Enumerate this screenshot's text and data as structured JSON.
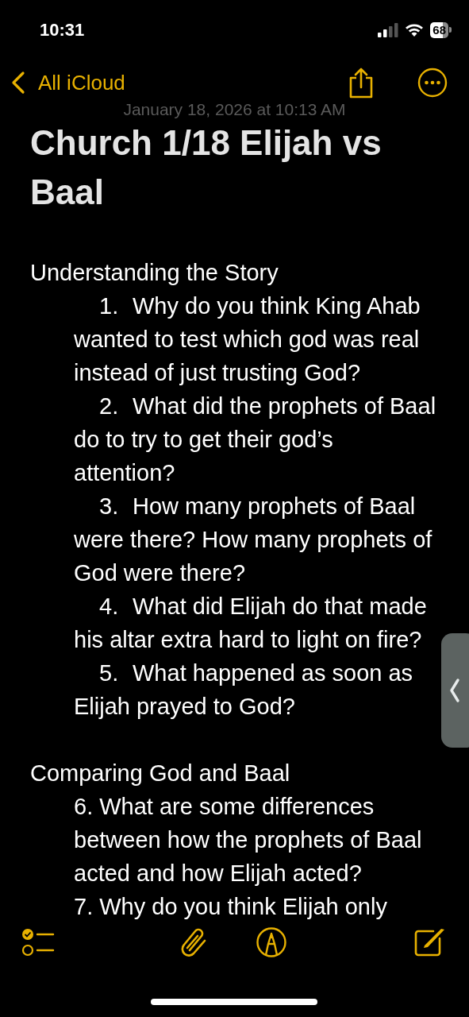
{
  "status_bar": {
    "time": "10:31",
    "battery": "68"
  },
  "nav": {
    "back_label": "All iCloud"
  },
  "note": {
    "date": "January 18, 2026 at 10:13 AM",
    "title": "Church 1/18 Elijah vs Baal",
    "sections": [
      {
        "heading": "Understanding the Story",
        "items": [
          {
            "kind": "numbered",
            "number": "1.",
            "text": "Why do you think King Ahab wanted to test which god was real instead of just trusting God?"
          },
          {
            "kind": "numbered",
            "number": "2.",
            "text": "What did the prophets of Baal do to try to get their god’s attention?"
          },
          {
            "kind": "numbered",
            "number": "3.",
            "text": "How many prophets of Baal were there? How many prophets of God were there?"
          },
          {
            "kind": "numbered",
            "number": "4.",
            "text": "What did Elijah do that made his altar extra hard to light on fire?"
          },
          {
            "kind": "numbered",
            "number": "5.",
            "text": "What happened as soon as Elijah prayed to God?"
          }
        ]
      },
      {
        "heading": "Comparing God and Baal",
        "items": [
          {
            "kind": "plain",
            "text": "6. What are some differences between how the prophets of Baal acted and how Elijah acted?"
          },
          {
            "kind": "plain",
            "text": "7. Why do you think Elijah only"
          }
        ]
      }
    ]
  }
}
